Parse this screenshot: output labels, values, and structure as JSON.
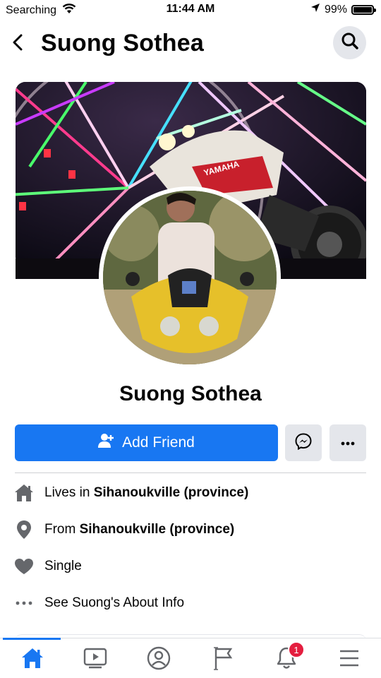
{
  "status_bar": {
    "carrier": "Searching",
    "time": "11:44 AM",
    "battery": "99%",
    "battery_level": 0.99,
    "icons": [
      "wifi-icon",
      "location-arrow-icon",
      "battery-icon"
    ]
  },
  "header": {
    "title": "Suong Sothea",
    "back_icon": "chevron-left-icon",
    "search_icon": "search-icon"
  },
  "profile": {
    "name": "Suong Sothea",
    "cover_label": "YAMAHA"
  },
  "actions": {
    "add_friend_label": "Add Friend",
    "add_friend_icon": "add-user-icon",
    "messenger_icon": "messenger-icon",
    "more_icon": "more-dots-icon",
    "accent_color": "#1877f2"
  },
  "info": {
    "lives_prefix": "Lives in ",
    "lives_place": "Sihanoukville (province)",
    "from_prefix": "From ",
    "from_place": "Sihanoukville (province)",
    "relationship": "Single",
    "about_link": "See Suong's About Info"
  },
  "tab_bar": {
    "tabs": [
      {
        "name": "home",
        "icon": "home-icon",
        "active": true
      },
      {
        "name": "watch",
        "icon": "video-icon",
        "active": false
      },
      {
        "name": "profile",
        "icon": "profile-icon",
        "active": false
      },
      {
        "name": "pages",
        "icon": "flag-icon",
        "active": false
      },
      {
        "name": "notifications",
        "icon": "bell-icon",
        "active": false
      },
      {
        "name": "menu",
        "icon": "hamburger-menu-icon",
        "active": false
      }
    ],
    "notification_count": "1"
  }
}
